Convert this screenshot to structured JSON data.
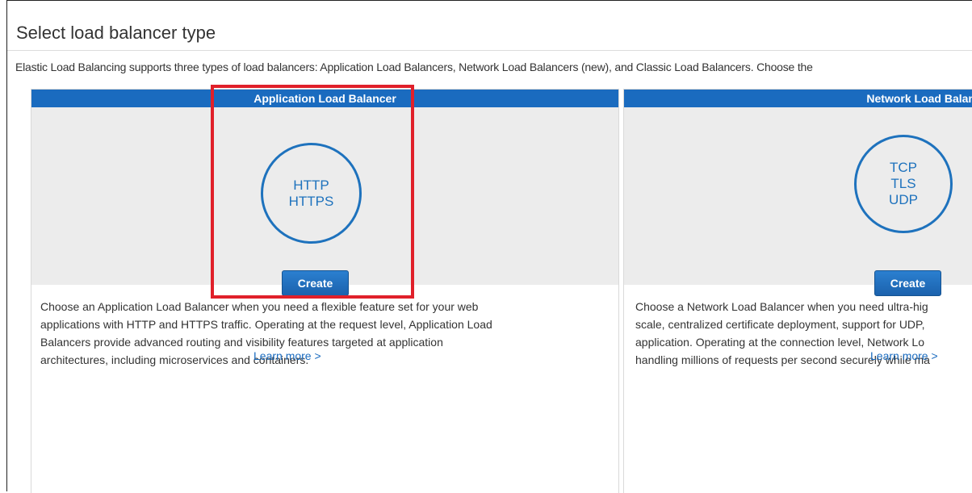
{
  "page": {
    "title": "Select load balancer type",
    "description": "Elastic Load Balancing supports three types of load balancers: Application Load Balancers, Network Load Balancers (new), and Classic Load Balancers. Choose the"
  },
  "cards": [
    {
      "header": "Application Load Balancer",
      "protocols": [
        "HTTP",
        "HTTPS"
      ],
      "create_label": "Create",
      "description_lines": [
        "Choose an Application Load Balancer when you need a flexible feature set for your web",
        "applications with HTTP and HTTPS traffic. Operating at the request level, Application Load",
        "Balancers provide advanced routing and visibility features targeted at application",
        "architectures, including microservices and containers."
      ],
      "learn_more": "Learn more >"
    },
    {
      "header": "Network Load Balancer",
      "protocols": [
        "TCP",
        "TLS",
        "UDP"
      ],
      "create_label": "Create",
      "description_lines": [
        "Choose a Network Load Balancer when you need ultra-hig",
        "scale, centralized certificate deployment, support for UDP,",
        "application. Operating at the connection level, Network Lo",
        "handling millions of requests per second securely while ma"
      ],
      "learn_more": "Learn more >"
    }
  ],
  "annotation": {
    "color": "#e0202a"
  },
  "colors": {
    "header_blue": "#1a6bbf",
    "hero_gray": "#ececec",
    "circle_blue": "#1e72bd"
  }
}
